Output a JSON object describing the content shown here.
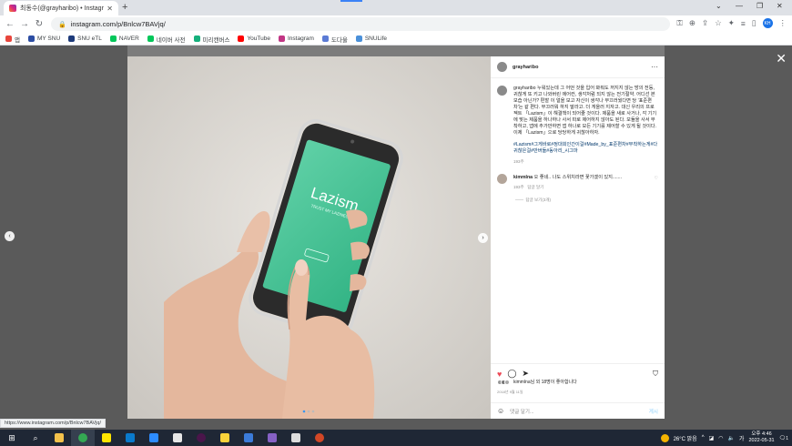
{
  "browser": {
    "tab_title": "최동수(@grayharibo) • Instagra",
    "new_tab": "+",
    "url": "instagram.com/p/Bnlcw7BAVjq/",
    "profile_initials": "KH"
  },
  "bookmarks": [
    {
      "label": "앱",
      "icon": "apps-grid-icon",
      "color": "#e8453c"
    },
    {
      "label": "MY SNU",
      "icon": "mysnu-icon",
      "color": "#2c4da3"
    },
    {
      "label": "SNU eTL",
      "icon": "etl-icon",
      "color": "#1d3a7a"
    },
    {
      "label": "NAVER",
      "icon": "naver-icon",
      "color": "#03c75a"
    },
    {
      "label": "네이버 사전",
      "icon": "naver-dict-icon",
      "color": "#03c75a"
    },
    {
      "label": "미리캔버스",
      "icon": "miricanvas-icon",
      "color": "#16b07c"
    },
    {
      "label": "YouTube",
      "icon": "youtube-icon",
      "color": "#ff0000"
    },
    {
      "label": "Instagram",
      "icon": "instagram-icon",
      "color": "#c13584"
    },
    {
      "label": "도다울",
      "icon": "dodaul-icon",
      "color": "#5b7bd5"
    },
    {
      "label": "SNULife",
      "icon": "snulife-icon",
      "color": "#4a90d9"
    }
  ],
  "post": {
    "username": "grayharibo",
    "phone_app_name": "Lazism",
    "phone_app_sub": "TRUST MY LAZINESS",
    "caption": "grayharibo 누워있는데 그 어떤 것을 입어 봐줘도 꺼지지 않는 방의 전등, 귀찮게 또 키고 나와버린 에어컨, 생각처럼 되지 않는 전기절약. 어디선 본 모습 아닌가? 편할 이 얼을 보고 자신이 생각나 부끄러웠다면 당 '표준편차'는 같 편다. 부끄러워 하지 말라고. 더 게을러 지자고. 대신 우리의 프로젝트 「Lazism」이 해결책이 되어줄 것이다. 제품을 새로 사거나, 각 기기에 맞는 제품을 하나하나 사서 따로 제어하지 않아도 된다. 모듈을 사서 부착하고, 앱에 추가만하면 앱 하나로 모든 기기를 제어할 수 있게 될 것이다. 이제 「Lazism」으로 당당하게 귀찮아하자.",
    "hashtags": "#Lazism#그게바로#정대회인간이걸#Made_by_표준편차#부착하는게#다귀찮은걸#만버들#동아리_시그마",
    "caption_time": "193주",
    "comment_user": "kimmlna",
    "comment_text": "오 좋네.. 나도 스위치라면 꽃가겠이 있지.......",
    "comment_time": "193주",
    "comment_reply": "답글 달기",
    "replies_label": "답글 보기(3개)",
    "likes_text": "kimmlna님 외 18명이 좋아합니다",
    "post_date": "2018년 9월 11일",
    "comment_placeholder": "댓글 달기...",
    "post_button": "게시"
  },
  "status_url": "https://www.instagram.com/p/Bnlcw7BAVjq/",
  "taskbar": {
    "weather": "26°C 맑음",
    "time": "오후 4:46",
    "date": "2022-05-31",
    "notification_count": "1"
  }
}
